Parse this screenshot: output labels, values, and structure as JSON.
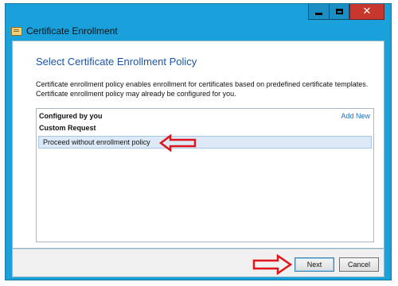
{
  "window": {
    "title": "Certificate Enrollment",
    "close_glyph": "✕"
  },
  "page": {
    "heading": "Select Certificate Enrollment Policy",
    "description_lines": [
      "Certificate enrollment policy enables enrollment for certificates based on predefined certificate templates.",
      "Certificate enrollment policy may already be configured for you."
    ]
  },
  "policy_list": {
    "group_label": "Configured by you",
    "add_new_label": "Add New",
    "section_label": "Custom Request",
    "selected_item_label": "Proceed without enrollment policy"
  },
  "footer": {
    "next_label": "Next",
    "cancel_label": "Cancel"
  },
  "colors": {
    "window_frame": "#1aa0db",
    "heading": "#1a55a8",
    "link": "#1a6fd1",
    "selection": "#dce9f7",
    "annotation_arrow": "#e0141b",
    "close_button": "#c7372d"
  },
  "icons": {
    "app": "certificate-icon",
    "annotation": "red-arrow-annotation"
  }
}
